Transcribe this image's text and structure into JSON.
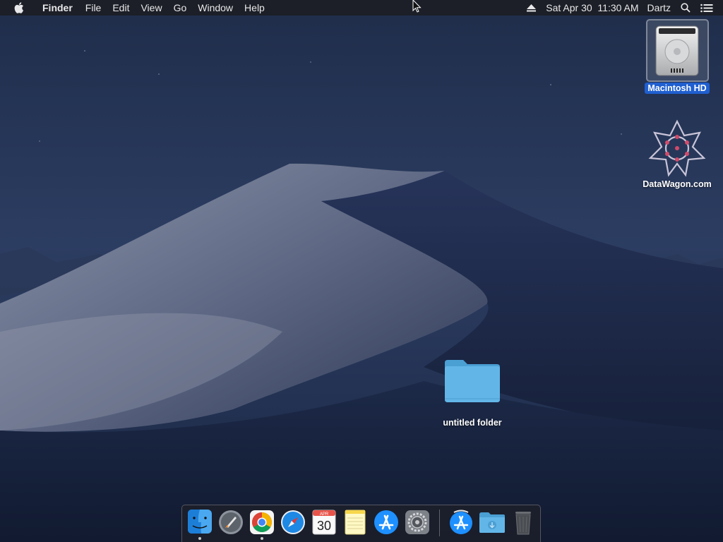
{
  "menubar": {
    "apple_icon": "apple-logo-icon",
    "app_name": "Finder",
    "items": [
      "File",
      "Edit",
      "View",
      "Go",
      "Window",
      "Help"
    ],
    "status": {
      "eject_icon": "eject-icon",
      "datetime": "Sat Apr 30  11:30 AM",
      "user": "Dartz",
      "spotlight_icon": "search-icon",
      "notification_icon": "list-icon"
    }
  },
  "desktop": {
    "icons": {
      "macintosh_hd": {
        "label": "Macintosh HD",
        "icon": "hard-drive-icon",
        "selected": true
      },
      "datawagon": {
        "label": "DataWagon.com",
        "icon": "datawagon-logo-icon",
        "selected": false
      },
      "untitled_folder": {
        "label": "untitled folder",
        "icon": "folder-icon",
        "selected": false
      }
    }
  },
  "dock": {
    "items": [
      {
        "name": "Finder",
        "icon": "finder-icon",
        "running": true
      },
      {
        "name": "Launchpad",
        "icon": "launchpad-icon",
        "running": false
      },
      {
        "name": "Google Chrome",
        "icon": "chrome-icon",
        "running": true
      },
      {
        "name": "Safari",
        "icon": "safari-icon",
        "running": false
      },
      {
        "name": "Calendar",
        "icon": "calendar-icon",
        "running": false,
        "month": "APR",
        "day": "30"
      },
      {
        "name": "Notes",
        "icon": "notes-icon",
        "running": false
      },
      {
        "name": "App Store",
        "icon": "app-store-icon",
        "running": false
      },
      {
        "name": "System Preferences",
        "icon": "system-preferences-icon",
        "running": false
      },
      {
        "name": "App Store Download",
        "icon": "app-store-download-icon",
        "running": false
      },
      {
        "name": "Downloads",
        "icon": "downloads-folder-icon",
        "running": false
      },
      {
        "name": "Trash",
        "icon": "trash-icon",
        "running": false
      }
    ]
  },
  "colors": {
    "selection": "#1f5fd0",
    "folder": "#5fb4e6",
    "menubar": "#1c1e24"
  }
}
